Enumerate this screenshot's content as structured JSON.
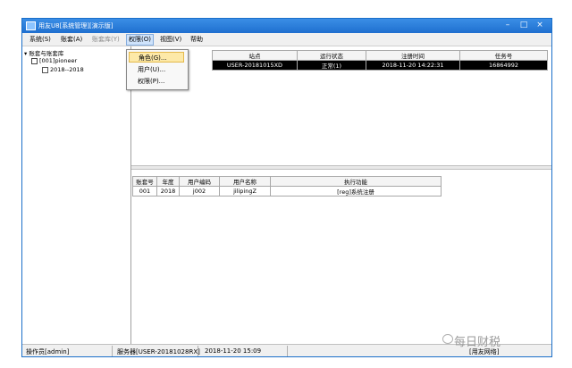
{
  "window": {
    "title": "用友U8[系统管理][演示版]"
  },
  "titlebar": {
    "minimize": "–",
    "maximize": "□",
    "close": "×"
  },
  "menubar": {
    "items": [
      {
        "label": "系统(S)"
      },
      {
        "label": "账套(A)"
      },
      {
        "label": "账套库(Y)"
      },
      {
        "label": "权限(O)"
      },
      {
        "label": "视图(V)"
      },
      {
        "label": "帮助"
      }
    ]
  },
  "permission_menu": {
    "items": [
      {
        "label": "角色(G)..."
      },
      {
        "label": "用户(U)..."
      },
      {
        "label": "权限(P)..."
      }
    ]
  },
  "tree": {
    "root": "账套与账套库",
    "account": "[001]pioneer",
    "year": "2018--2018"
  },
  "top_grid": {
    "columns": [
      "站点",
      "运行状态",
      "注册时间",
      "任务号"
    ],
    "rows": [
      {
        "cells": [
          "USER-20181015XD",
          "正常(1)",
          "2018-11-20 14:22:31",
          "16864992"
        ]
      }
    ]
  },
  "bottom_grid": {
    "columns": [
      "账套号",
      "年度",
      "用户编码",
      "用户名称",
      "执行功能"
    ],
    "rows": [
      {
        "cells": [
          "001",
          "2018",
          "j002",
          "jilipingZ",
          "[reg]系统注册"
        ]
      }
    ]
  },
  "status": {
    "operator": "操作员[admin]",
    "server": "服务器[USER-20181028RX]",
    "datetime": "2018-11-20 15:09",
    "vendor": "[用友网络]"
  },
  "watermark": {
    "text": "每日财税"
  }
}
